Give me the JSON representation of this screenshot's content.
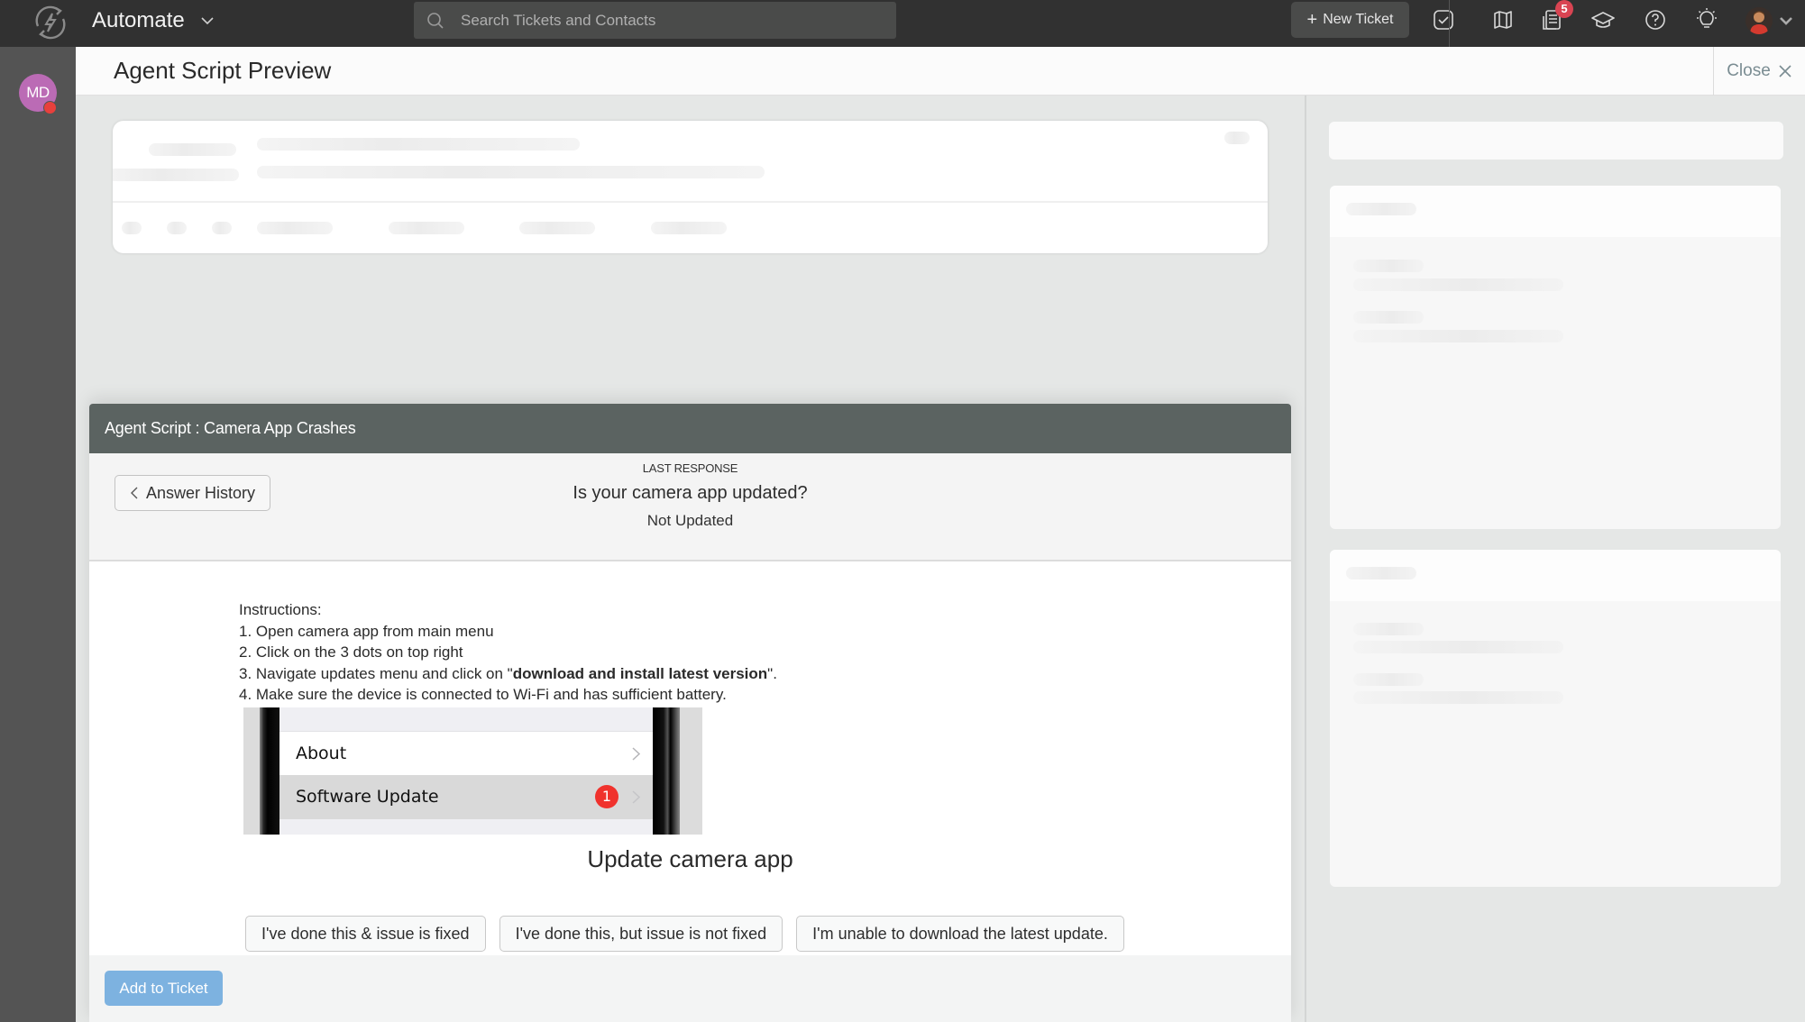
{
  "topbar": {
    "app_name": "Automate",
    "search_placeholder": "Search Tickets and Contacts",
    "new_ticket_label": "New Ticket",
    "notification_count": "5",
    "icons": [
      "tasks-check-icon",
      "map-icon",
      "notifications-icon",
      "academy-icon",
      "help-icon",
      "ideas-bulb-icon",
      "user-avatar"
    ]
  },
  "rail": {
    "avatar_initials": "MD",
    "status_color": "#e8403c"
  },
  "page": {
    "title": "Agent Script Preview",
    "close_label": "Close"
  },
  "script": {
    "header": "Agent Script : Camera App Crashes",
    "history_button": "Answer History",
    "last_response_label": "LAST RESPONSE",
    "last_question": "Is your camera app updated?",
    "last_answer": "Not Updated",
    "instructions": {
      "heading": "Instructions:",
      "steps": [
        "1. Open camera app from main menu",
        "2. Click on the 3 dots on top right",
        "3. Navigate updates menu and click on \"",
        "4. Make sure the device is connected to Wi-Fi and has sufficient battery."
      ],
      "step3_bold": "download and install latest version",
      "step3_suffix": "\"."
    },
    "image": {
      "row1": "About",
      "row2": "Software Update",
      "badge": "1"
    },
    "step_title": "Update camera app",
    "answers": [
      "I've done this & issue is fixed",
      "I've done this, but issue is not fixed",
      "I'm unable to download the latest update."
    ],
    "add_button": "Add to Ticket"
  },
  "colors": {
    "topbar_bg": "#313131",
    "script_header_bg": "#5b6361",
    "add_button_bg": "#7db2e0",
    "badge_bg": "#d94452"
  }
}
